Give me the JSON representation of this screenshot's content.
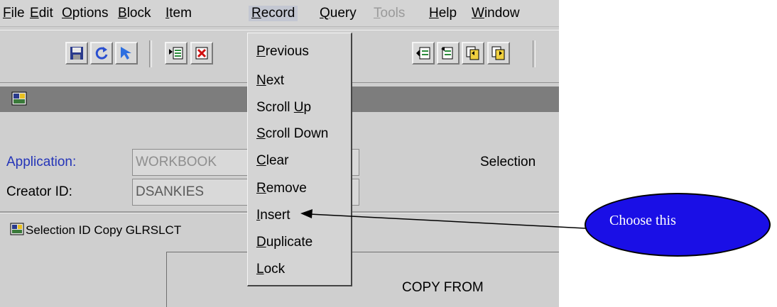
{
  "menubar": {
    "items": [
      {
        "label": "File",
        "underline": "F",
        "rest": "ile"
      },
      {
        "label": "Edit",
        "underline": "E",
        "rest": "dit"
      },
      {
        "label": "Options",
        "underline": "O",
        "rest": "ptions"
      },
      {
        "label": "Block",
        "underline": "B",
        "rest": "lock"
      },
      {
        "label": "Item",
        "underline": "I",
        "rest": "tem"
      },
      {
        "label": "Record",
        "underline": "R",
        "rest": "ecord"
      },
      {
        "label": "Query",
        "underline": "Q",
        "rest": "uery"
      },
      {
        "label": "Tools",
        "underline": "T",
        "rest": "ools"
      },
      {
        "label": "Help",
        "underline": "H",
        "rest": "elp"
      },
      {
        "label": "Window",
        "underline": "W",
        "rest": "indow"
      }
    ],
    "active": "Record",
    "disabled": [
      "Tools"
    ]
  },
  "toolbar": {
    "buttons": [
      {
        "icon": "save-icon"
      },
      {
        "icon": "rollback-icon"
      },
      {
        "icon": "exit-icon"
      },
      {
        "icon": "insert-record-icon"
      },
      {
        "icon": "delete-record-icon"
      },
      {
        "icon": "print-icon"
      },
      {
        "icon": "previous-block-icon"
      },
      {
        "icon": "next-block-icon"
      },
      {
        "icon": "previous-record-icon"
      },
      {
        "icon": "next-record-icon"
      }
    ]
  },
  "form": {
    "application_label": "Application:",
    "application_value": "WORKBOOK",
    "creator_label": "Creator ID:",
    "creator_value": "DSANKIES",
    "selection_label": "Selection",
    "subwindow_title": "Selection ID Copy  GLRSLCT",
    "copy_from_label": "COPY FROM"
  },
  "record_menu": {
    "items": [
      {
        "u": "P",
        "rest": "revious",
        "pre": ""
      },
      {
        "u": "N",
        "rest": "ext",
        "pre": ""
      },
      {
        "u": "U",
        "rest": "p",
        "pre": "Scroll "
      },
      {
        "u": "S",
        "rest": "croll Down",
        "pre": ""
      },
      {
        "u": "C",
        "rest": "lear",
        "pre": ""
      },
      {
        "u": "R",
        "rest": "emove",
        "pre": ""
      },
      {
        "u": "I",
        "rest": "nsert",
        "pre": ""
      },
      {
        "u": "D",
        "rest": "uplicate",
        "pre": ""
      },
      {
        "u": "L",
        "rest": "ock",
        "pre": ""
      }
    ]
  },
  "annotation": {
    "text": "Choose this",
    "fill": "#1a0fe6"
  },
  "colors": {
    "label_blue": "#2434b8",
    "disabled_gray": "#9a9a9a"
  }
}
